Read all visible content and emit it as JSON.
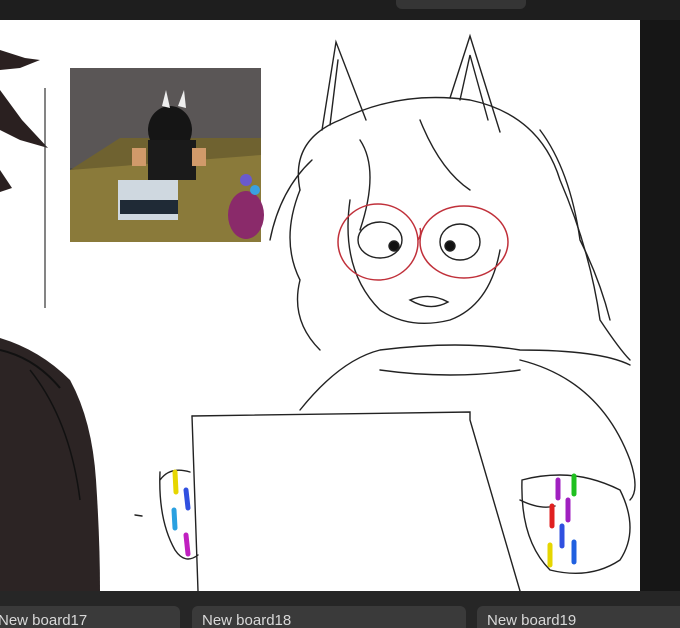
{
  "colors": {
    "chrome_dark": "#1e1e1e",
    "tab_background": "#3a3a3a",
    "tab_text": "#d8d8d8",
    "canvas": "#ffffff",
    "sketch_line": "#222222",
    "glasses_line": "#c0303a"
  },
  "board_tabs": [
    {
      "label": "New board17"
    },
    {
      "label": "New board18"
    },
    {
      "label": "New board19"
    }
  ],
  "canvas": {
    "content": "sketch-drawing",
    "reference_image": "roblox-avatar-at-laptop"
  }
}
